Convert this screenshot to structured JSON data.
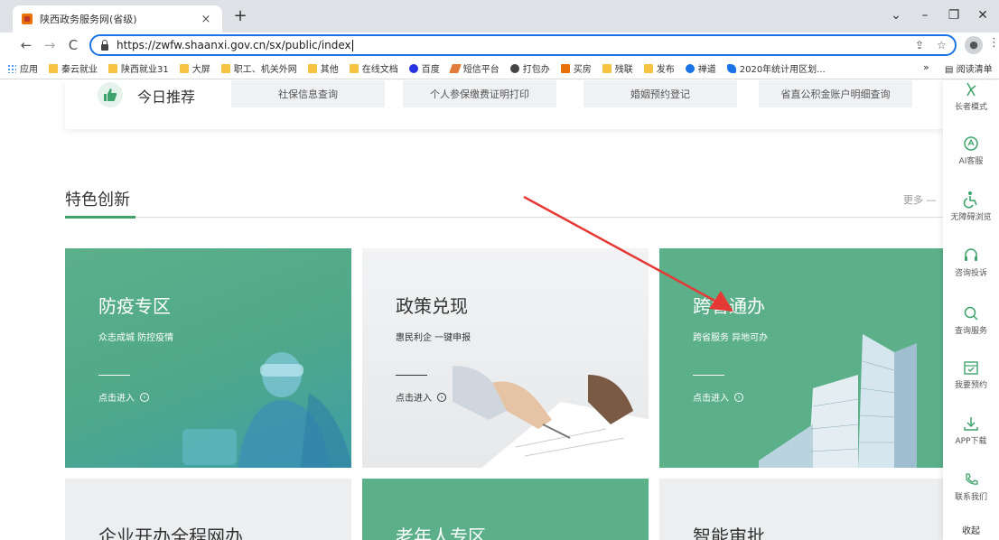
{
  "browser": {
    "tab_title": "陕西政务服务网(省级)",
    "tab_close": "×",
    "new_tab": "+",
    "url": "https://zwfw.shaanxi.gov.cn/sx/public/index",
    "window_controls": {
      "minimize": "–",
      "restore": "❐",
      "close": "✕",
      "dropdown": "⌄"
    },
    "nav": {
      "back": "←",
      "forward": "→",
      "reload": "C"
    }
  },
  "bookmarks": [
    {
      "label": "应用",
      "icon": "apps-icon",
      "color": "#1a73e8"
    },
    {
      "label": "秦云就业",
      "icon": "folder-icon",
      "color": "#f6c342"
    },
    {
      "label": "陕西就业31",
      "icon": "folder-icon",
      "color": "#f6c342"
    },
    {
      "label": "大屏",
      "icon": "folder-icon",
      "color": "#f6c342"
    },
    {
      "label": "职工、机关外网",
      "icon": "folder-icon",
      "color": "#f6c342"
    },
    {
      "label": "其他",
      "icon": "folder-icon",
      "color": "#f6c342"
    },
    {
      "label": "在线文档",
      "icon": "folder-icon",
      "color": "#f6c342"
    },
    {
      "label": "百度",
      "icon": "baidu-icon",
      "color": "#2932e1"
    },
    {
      "label": "短信平台",
      "icon": "pen-icon",
      "color": "#e07b39"
    },
    {
      "label": "打包办",
      "icon": "globe-icon",
      "color": "#444444"
    },
    {
      "label": "买房",
      "icon": "house-icon",
      "color": "#e8710a"
    },
    {
      "label": "残联",
      "icon": "folder-icon",
      "color": "#f6c342"
    },
    {
      "label": "发布",
      "icon": "folder-icon",
      "color": "#f6c342"
    },
    {
      "label": "禅道",
      "icon": "zentao-icon",
      "color": "#1a73e8"
    },
    {
      "label": "2020年统计用区划...",
      "icon": "stats-icon",
      "color": "#1a73e8"
    }
  ],
  "bookmarks_more": "»",
  "reading_list": "阅读清单",
  "today": {
    "title": "今日推荐",
    "buttons": [
      "社保信息查询",
      "个人参保缴费证明打印",
      "婚姻预约登记",
      "省直公积金账户明细查询"
    ]
  },
  "feature": {
    "title": "特色创新",
    "more": "更多 —",
    "enter_label": "点击进入",
    "cards": [
      {
        "title": "防疫专区",
        "sub": "众志成城 防控疫情",
        "style": "green"
      },
      {
        "title": "政策兑现",
        "sub": "惠民利企 一键申报",
        "style": "grey"
      },
      {
        "title": "跨省通办",
        "sub": "跨省服务 异地可办",
        "style": "green"
      }
    ],
    "cards_row2": [
      {
        "title": "企业开办全程网办",
        "style": "grey"
      },
      {
        "title": "老年人专区",
        "style": "green"
      },
      {
        "title": "智能审批",
        "style": "grey"
      }
    ]
  },
  "sidebar": [
    {
      "label": "长者模式",
      "icon": "elder-icon"
    },
    {
      "label": "AI客服",
      "icon": "ai-service-icon"
    },
    {
      "label": "无障碍浏览",
      "icon": "accessibility-icon"
    },
    {
      "label": "咨询投诉",
      "icon": "headset-icon"
    },
    {
      "label": "查询服务",
      "icon": "search-icon"
    },
    {
      "label": "我要预约",
      "icon": "calendar-icon"
    },
    {
      "label": "APP下载",
      "icon": "download-icon"
    },
    {
      "label": "联系我们",
      "icon": "phone-icon"
    },
    {
      "label": "收起",
      "icon": ""
    }
  ],
  "colors": {
    "accent": "#3ea36b",
    "card_green": "#5bb08a",
    "card_grey": "#eceeef",
    "arrow": "#e53935",
    "omnibox": "#1a73e8"
  }
}
